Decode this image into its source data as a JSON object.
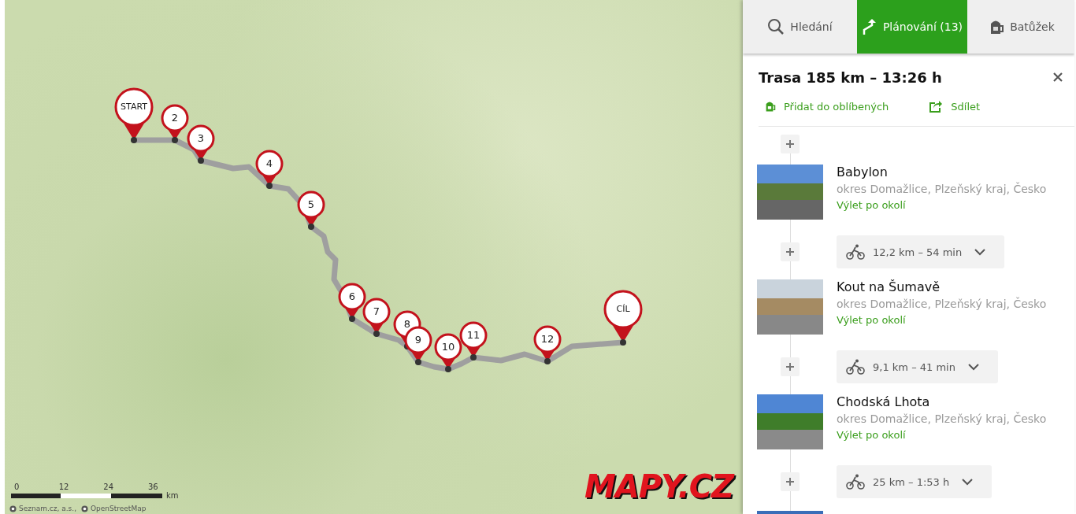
{
  "map": {
    "markers": [
      {
        "label": "START",
        "kind": "end"
      },
      {
        "label": "2",
        "kind": "via"
      },
      {
        "label": "3",
        "kind": "via"
      },
      {
        "label": "4",
        "kind": "via"
      },
      {
        "label": "5",
        "kind": "via"
      },
      {
        "label": "6",
        "kind": "via"
      },
      {
        "label": "7",
        "kind": "via"
      },
      {
        "label": "8",
        "kind": "via"
      },
      {
        "label": "9",
        "kind": "via"
      },
      {
        "label": "10",
        "kind": "via"
      },
      {
        "label": "11",
        "kind": "via"
      },
      {
        "label": "12",
        "kind": "via"
      },
      {
        "label": "CÍL",
        "kind": "end"
      }
    ],
    "scale": {
      "ticks": [
        "0",
        "12",
        "24",
        "36"
      ],
      "unit": "km"
    },
    "attribution": [
      "Seznam.cz, a.s.,",
      "OpenStreetMap"
    ],
    "logo": "MAPY.CZ"
  },
  "tabs": [
    {
      "label": "Hledání",
      "selected": false
    },
    {
      "label": "Plánování (13)",
      "selected": true
    },
    {
      "label": "Batůžek",
      "selected": false
    }
  ],
  "route": {
    "title": "Trasa 185 km – 13:26 h",
    "actions": [
      "Přidat do oblíbených",
      "Sdílet"
    ]
  },
  "timeline": [
    {
      "kind": "add"
    },
    {
      "kind": "waypoint",
      "name": "Babylon",
      "region": "okres Domažlice, Plzeňský kraj, Česko",
      "link": "Výlet po okolí"
    },
    {
      "kind": "leg",
      "distance": "12,2 km – 54 min"
    },
    {
      "kind": "waypoint",
      "name": "Kout na Šumavě",
      "region": "okres Domažlice, Plzeňský kraj, Česko",
      "link": "Výlet po okolí"
    },
    {
      "kind": "leg",
      "distance": "9,1 km – 41 min"
    },
    {
      "kind": "waypoint",
      "name": "Chodská Lhota",
      "region": "okres Domažlice, Plzeňský kraj, Česko",
      "link": "Výlet po okolí"
    },
    {
      "kind": "leg",
      "distance": "25 km – 1:53 h"
    },
    {
      "kind": "partial"
    }
  ]
}
